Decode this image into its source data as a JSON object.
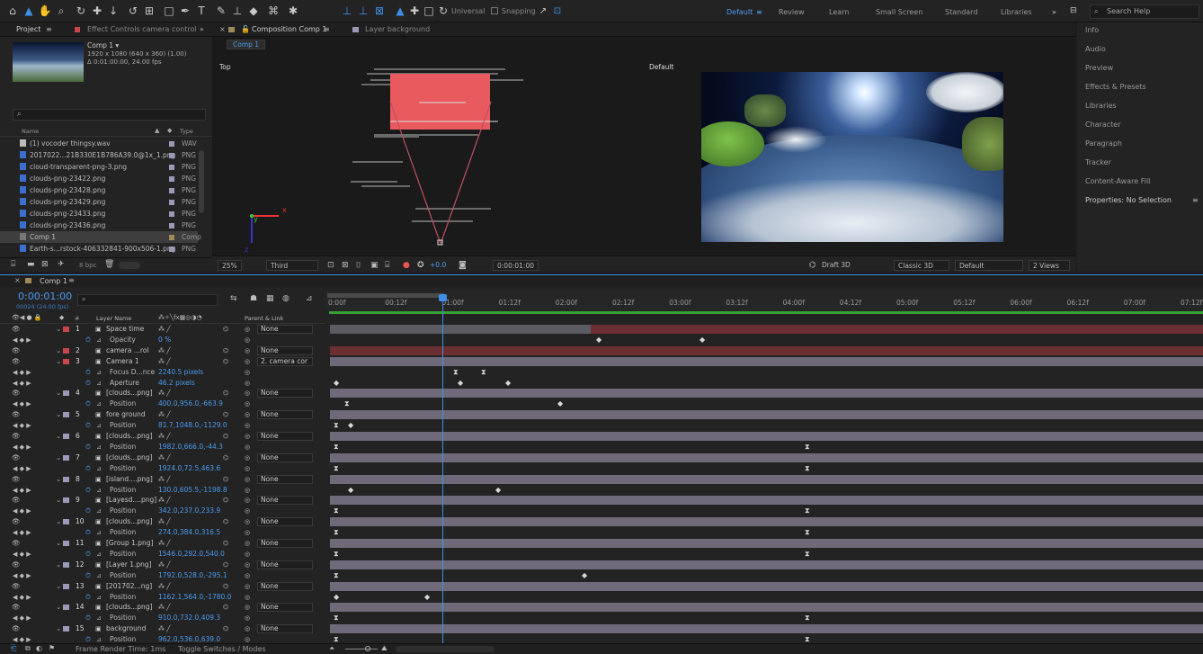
{
  "toolbar": {
    "tools": [
      "home-icon",
      "selection-icon",
      "hand-icon",
      "zoom-icon",
      "orbit-icon",
      "pan-icon",
      "dolly-icon",
      "rotate-icon",
      "pan-behind-icon",
      "rectangle-icon",
      "pen-icon",
      "type-icon",
      "brush-icon",
      "clone-icon",
      "eraser-icon",
      "roto-icon",
      "puppet-icon"
    ],
    "universal_label": "Universal",
    "snapping_label": "Snapping"
  },
  "workspaces": {
    "items": [
      "Default",
      "Review",
      "Learn",
      "Small Screen",
      "Standard",
      "Libraries"
    ],
    "search_placeholder": "Search Help"
  },
  "project": {
    "tab_label": "Project",
    "effects_tab": "Effect Controls camera control",
    "comp_name": "Comp 1 ▾",
    "comp_info1": "1920 x 1080 (640 x 360) (1.00)",
    "comp_info2": "Δ 0:01:00:00, 24.00 fps",
    "col_name": "Name",
    "col_type": "Type",
    "files": [
      {
        "name": "(1) vocoder thingsy.wav",
        "type": "WAV"
      },
      {
        "name": "2017022...21B330E1B786A39.0@1x_1.png",
        "type": "PNG"
      },
      {
        "name": "cloud-transparent-png-3.png",
        "type": "PNG"
      },
      {
        "name": "clouds-png-23422.png",
        "type": "PNG"
      },
      {
        "name": "clouds-png-23428.png",
        "type": "PNG"
      },
      {
        "name": "clouds-png-23429.png",
        "type": "PNG"
      },
      {
        "name": "clouds-png-23433.png",
        "type": "PNG"
      },
      {
        "name": "clouds-png-23436.png",
        "type": "PNG"
      },
      {
        "name": "Comp 1",
        "type": "Comp"
      },
      {
        "name": "Earth-s...rstock-406332841-900x506-1.png",
        "type": "PNG"
      }
    ],
    "bpc": "8 bpc"
  },
  "viewer": {
    "tab_label": "Composition Comp 1",
    "layer_tab": "Layer background",
    "comp_chip": "Comp 1",
    "top_label": "Top",
    "default_label": "Default",
    "zoom": "25%",
    "res": "Third",
    "exposure": "+0.0",
    "timecode": "0:00:01:00",
    "draft3d": "Draft 3D",
    "renderer": "Classic 3D",
    "view": "Default",
    "views": "2 Views"
  },
  "rightpanel": {
    "items": [
      "Info",
      "Audio",
      "Preview",
      "Effects & Presets",
      "Libraries",
      "Character",
      "Paragraph",
      "Tracker",
      "Content-Aware Fill",
      "Properties: No Selection"
    ]
  },
  "timeline": {
    "tab": "Comp 1",
    "timecode": "0:00:01:00",
    "frames": "00024 (24.00 fps)",
    "col_layer": "Layer Name",
    "col_parent": "Parent & Link",
    "ruler": [
      "0:00f",
      "00:12f",
      "01:00f",
      "01:12f",
      "02:00f",
      "02:12f",
      "03:00f",
      "03:12f",
      "04:00f",
      "04:12f",
      "05:00f",
      "05:12f",
      "06:00f",
      "06:12f",
      "07:00f",
      "07:12f"
    ],
    "rows": [
      {
        "num": "1",
        "name": "Space time",
        "parent": "None",
        "kind": "layer",
        "color": "#c9464b"
      },
      {
        "name": "Opacity",
        "value": "0 %",
        "kind": "prop"
      },
      {
        "num": "2",
        "name": "camera ...rol",
        "parent": "None",
        "kind": "layer",
        "color": "#c9464b"
      },
      {
        "num": "3",
        "name": "Camera 1",
        "parent": "2. camera cor",
        "kind": "layer",
        "color": "#c9464b"
      },
      {
        "name": "Focus D...nce",
        "value": "2240.5 pixels",
        "kind": "prop"
      },
      {
        "name": "Aperture",
        "value": "46.2 pixels",
        "kind": "prop"
      },
      {
        "num": "4",
        "name": "[clouds...png]",
        "parent": "None",
        "kind": "layer",
        "color": "#9a9ab8"
      },
      {
        "name": "Position",
        "value": "400.0,956.0,-663.9",
        "kind": "prop"
      },
      {
        "num": "5",
        "name": "fore ground",
        "parent": "None",
        "kind": "layer",
        "color": "#9a9ab8"
      },
      {
        "name": "Position",
        "value": "81.7,1048.0,-1129.0",
        "kind": "prop"
      },
      {
        "num": "6",
        "name": "[clouds...png]",
        "parent": "None",
        "kind": "layer",
        "color": "#9a9ab8"
      },
      {
        "name": "Position",
        "value": "1982.0,666.0,-44.3",
        "kind": "prop"
      },
      {
        "num": "7",
        "name": "[clouds...png]",
        "parent": "None",
        "kind": "layer",
        "color": "#9a9ab8"
      },
      {
        "name": "Position",
        "value": "1924.0,72.5,463.6",
        "kind": "prop"
      },
      {
        "num": "8",
        "name": "[island....png]",
        "parent": "None",
        "kind": "layer",
        "color": "#9a9ab8"
      },
      {
        "name": "Position",
        "value": "130.0,605.5,-1198.8",
        "kind": "prop"
      },
      {
        "num": "9",
        "name": "[Layesd....png]",
        "parent": "None",
        "kind": "layer",
        "color": "#9a9ab8"
      },
      {
        "name": "Position",
        "value": "342.0,237.0,233.9",
        "kind": "prop"
      },
      {
        "num": "10",
        "name": "[clouds...png]",
        "parent": "None",
        "kind": "layer",
        "color": "#9a9ab8"
      },
      {
        "name": "Position",
        "value": "274.0,384.0,316.5",
        "kind": "prop"
      },
      {
        "num": "11",
        "name": "[Group 1.png]",
        "parent": "None",
        "kind": "layer",
        "color": "#9a9ab8"
      },
      {
        "name": "Position",
        "value": "1546.0,292.0,540.0",
        "kind": "prop"
      },
      {
        "num": "12",
        "name": "[Layer 1.png]",
        "parent": "None",
        "kind": "layer",
        "color": "#9a9ab8"
      },
      {
        "name": "Position",
        "value": "1792.0,528.0,-295.1",
        "kind": "prop"
      },
      {
        "num": "13",
        "name": "[201702...ng]",
        "parent": "None",
        "kind": "layer",
        "color": "#9a9ab8"
      },
      {
        "name": "Position",
        "value": "1162.1,564.0,-1780.0",
        "kind": "prop"
      },
      {
        "num": "14",
        "name": "[clouds...png]",
        "parent": "None",
        "kind": "layer",
        "color": "#9a9ab8"
      },
      {
        "name": "Position",
        "value": "910.0,732.0,409.3",
        "kind": "prop"
      },
      {
        "num": "15",
        "name": "background",
        "parent": "None",
        "kind": "layer",
        "color": "#9a9ab8"
      },
      {
        "name": "Position",
        "value": "962.0,536.0,639.0",
        "kind": "prop"
      }
    ],
    "footer_render": "Frame Render Time: 1ms",
    "footer_toggle": "Toggle Switches / Modes"
  }
}
